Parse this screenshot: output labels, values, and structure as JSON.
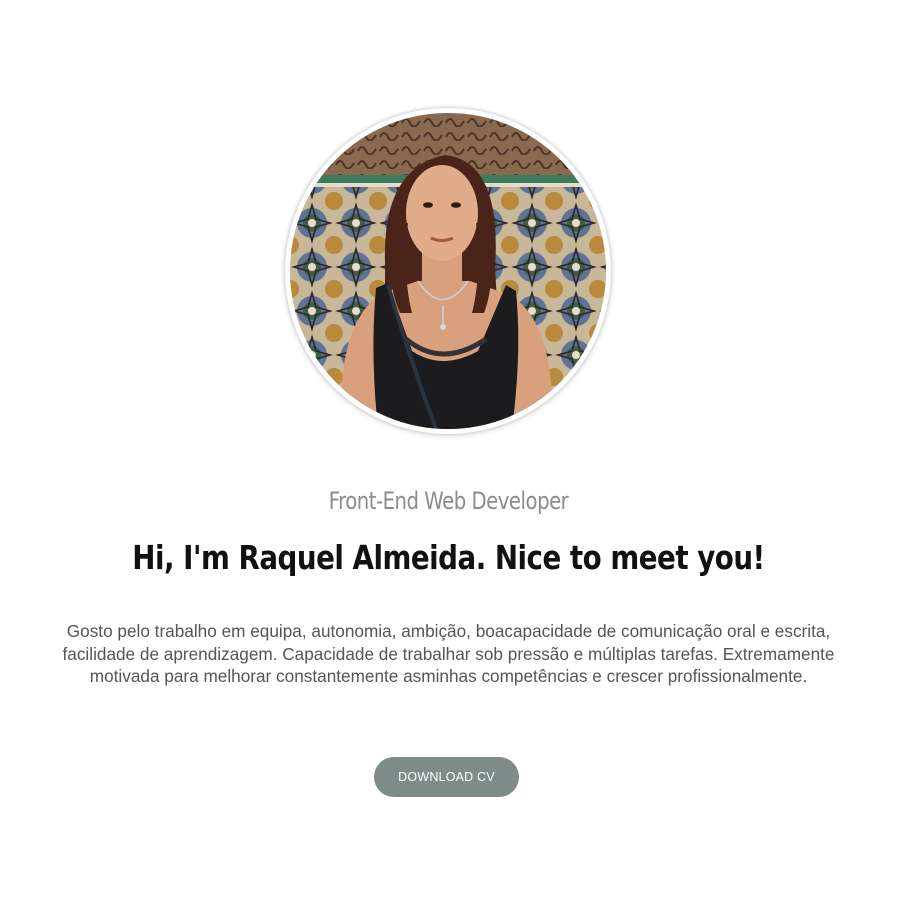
{
  "profile": {
    "photo_alt": "Raquel Almeida",
    "role": "Front-End Web Developer",
    "greeting": "Hi, I'm Raquel Almeida. Nice to meet you!",
    "bio": "Gosto pelo trabalho em equipa, autonomia, ambição, boacapacidade de comunicação oral e escrita, facilidade de aprendizagem. Capacidade de trabalhar sob pressão e múltiplas tarefas. Extremamente motivada para melhorar constantemente asminhas competências e crescer profissionalmente.",
    "cv_button_label": "DOWNLOAD CV"
  },
  "colors": {
    "button_bg": "#7e8c89",
    "subtitle": "#8c8c8c",
    "headline": "#111111",
    "body_text": "#555555"
  }
}
